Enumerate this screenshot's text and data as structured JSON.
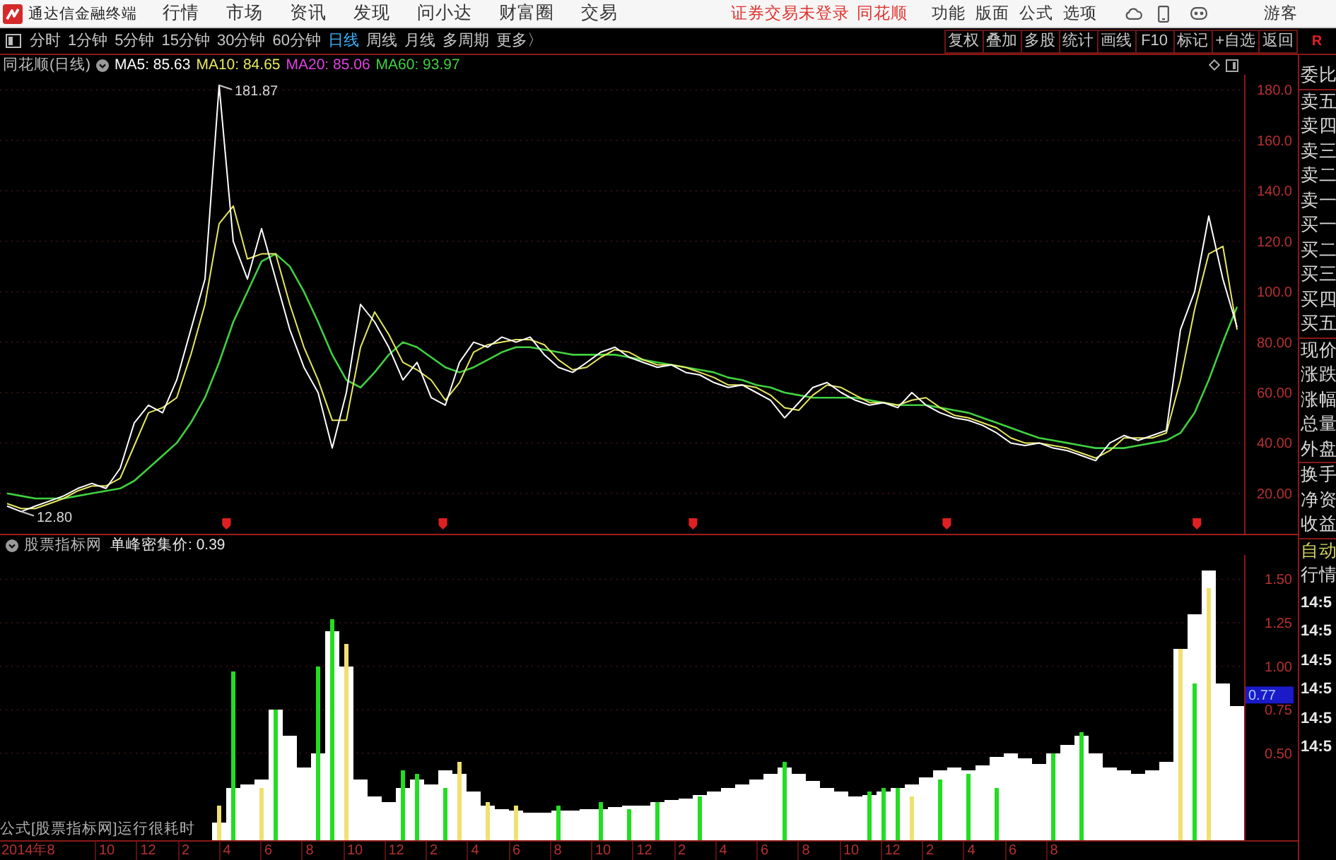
{
  "top_bar": {
    "app_title": "通达信金融终端",
    "menu": [
      "行情",
      "市场",
      "资讯",
      "发现",
      "问小达",
      "财富圈",
      "交易"
    ],
    "login_status": "证券交易未登录",
    "broker": "同花顺",
    "right_menu": [
      "功能",
      "版面",
      "公式",
      "选项"
    ],
    "user": "游客"
  },
  "toolbar": {
    "periods": [
      {
        "label": "分时",
        "selected": false
      },
      {
        "label": "1分钟",
        "selected": false
      },
      {
        "label": "5分钟",
        "selected": false
      },
      {
        "label": "15分钟",
        "selected": false
      },
      {
        "label": "30分钟",
        "selected": false
      },
      {
        "label": "60分钟",
        "selected": false
      },
      {
        "label": "日线",
        "selected": true
      },
      {
        "label": "周线",
        "selected": false
      },
      {
        "label": "月线",
        "selected": false
      },
      {
        "label": "多周期",
        "selected": false
      }
    ],
    "more_button": "更多〉",
    "buttons": [
      "复权",
      "叠加",
      "多股",
      "统计",
      "画线",
      "F10",
      "标记",
      "+自选",
      "返回"
    ],
    "corner_mark": "R"
  },
  "main_chart": {
    "title": "同花顺(日线)",
    "ma_readings": [
      {
        "text": "MA5: 85.63",
        "color": "#ffffff"
      },
      {
        "text": "MA10: 84.65",
        "color": "#e8e860"
      },
      {
        "text": "MA20: 85.06",
        "color": "#e040e0"
      },
      {
        "text": "MA60: 93.97",
        "color": "#40d040"
      }
    ],
    "chart_data": {
      "type": "line",
      "ylim": [
        4,
        186
      ],
      "grid": true,
      "yticks": [
        {
          "value": 180,
          "label": "180.0"
        },
        {
          "value": 160,
          "label": "160.0"
        },
        {
          "value": 140,
          "label": "140.0"
        },
        {
          "value": 120,
          "label": "120.0"
        },
        {
          "value": 100,
          "label": "100.0"
        },
        {
          "value": 80,
          "label": "80.00"
        },
        {
          "value": 60,
          "label": "60.00"
        },
        {
          "value": 40,
          "label": "40.00"
        },
        {
          "value": 20,
          "label": "20.00"
        }
      ],
      "series": [
        {
          "color": "#40d040",
          "values": [
            20,
            19,
            18,
            18,
            18,
            19,
            20,
            21,
            22,
            25,
            30,
            35,
            40,
            48,
            58,
            72,
            88,
            100,
            112,
            115,
            110,
            100,
            88,
            75,
            65,
            62,
            68,
            75,
            80,
            78,
            74,
            70,
            68,
            70,
            73,
            76,
            78,
            78,
            77,
            76,
            75,
            75,
            75,
            75,
            74,
            73,
            72,
            71,
            70,
            69,
            68,
            66,
            65,
            63,
            62,
            60,
            59,
            58,
            58,
            58,
            58,
            57,
            56,
            55,
            55,
            55,
            54,
            53,
            52,
            50,
            48,
            46,
            44,
            42,
            41,
            40,
            39,
            38,
            38,
            38,
            39,
            40,
            41,
            44,
            52,
            65,
            80,
            94
          ]
        },
        {
          "color": "#e8e860",
          "values": [
            16,
            14,
            14,
            16,
            18,
            21,
            23,
            23,
            26,
            39,
            52,
            54,
            58,
            75,
            95,
            127,
            134,
            113,
            115,
            115,
            95,
            78,
            65,
            49,
            49,
            78,
            92,
            83,
            72,
            69,
            65,
            57,
            64,
            76,
            79,
            80,
            81,
            81,
            79,
            73,
            69,
            70,
            74,
            77,
            76,
            73,
            71,
            71,
            70,
            68,
            66,
            63,
            63,
            62,
            59,
            54,
            53,
            59,
            63,
            62,
            59,
            56,
            56,
            55,
            57,
            58,
            54,
            51,
            50,
            48,
            46,
            42,
            40,
            40,
            39,
            38,
            36,
            34,
            37,
            42,
            42,
            42,
            44,
            65,
            93,
            115,
            118,
            85
          ]
        },
        {
          "color": "#ffffff",
          "values": [
            15,
            12.8,
            15,
            17,
            19,
            22,
            24,
            22,
            30,
            48,
            55,
            52,
            65,
            85,
            105,
            181.87,
            120,
            105,
            125,
            105,
            85,
            70,
            60,
            38,
            60,
            95,
            88,
            78,
            65,
            72,
            58,
            55,
            72,
            80,
            78,
            82,
            80,
            82,
            75,
            70,
            68,
            72,
            76,
            78,
            74,
            72,
            70,
            71,
            68,
            67,
            64,
            62,
            63,
            60,
            57,
            50,
            56,
            62,
            64,
            60,
            57,
            55,
            56,
            54,
            60,
            55,
            52,
            50,
            49,
            47,
            44,
            40,
            39,
            40,
            38,
            37,
            35,
            33,
            40,
            43,
            41,
            43,
            45,
            85,
            100,
            130,
            105,
            86
          ]
        }
      ],
      "annotations": [
        "181.87",
        "12.80"
      ]
    }
  },
  "indicator_chart": {
    "name": "股票指标网",
    "reading": "单峰密集价: 0.39",
    "note": "公式[股票指标网]运行很耗时",
    "chart_data": {
      "type": "bar",
      "ylim": [
        0,
        1.64
      ],
      "grid": true,
      "yticks": [
        {
          "value": 1.5,
          "label": "1.50"
        },
        {
          "value": 1.25,
          "label": "1.25"
        },
        {
          "value": 1.0,
          "label": "1.00"
        },
        {
          "value": 0.75,
          "label": "0.75"
        },
        {
          "value": 0.5,
          "label": "0.50"
        }
      ],
      "series": [
        {
          "color": "#ffffff",
          "values": [
            0,
            0,
            0,
            0,
            0,
            0,
            0,
            0,
            0,
            0,
            0,
            0,
            0,
            0,
            0,
            0.1,
            0.3,
            0.32,
            0.35,
            0.75,
            0.6,
            0.42,
            0.5,
            1.2,
            1.0,
            0.35,
            0.25,
            0.22,
            0.3,
            0.35,
            0.32,
            0.4,
            0.38,
            0.28,
            0.2,
            0.18,
            0.17,
            0.16,
            0.16,
            0.17,
            0.17,
            0.18,
            0.18,
            0.19,
            0.2,
            0.2,
            0.22,
            0.23,
            0.24,
            0.26,
            0.28,
            0.3,
            0.32,
            0.35,
            0.38,
            0.42,
            0.38,
            0.34,
            0.3,
            0.28,
            0.25,
            0.26,
            0.28,
            0.3,
            0.32,
            0.36,
            0.4,
            0.42,
            0.4,
            0.43,
            0.48,
            0.5,
            0.47,
            0.44,
            0.5,
            0.55,
            0.6,
            0.5,
            0.42,
            0.4,
            0.38,
            0.4,
            0.45,
            1.1,
            1.3,
            1.55,
            0.9,
            0.77
          ]
        },
        {
          "color": "#22dd22",
          "values": [
            null,
            null,
            null,
            null,
            null,
            null,
            null,
            null,
            null,
            null,
            null,
            null,
            null,
            null,
            null,
            null,
            0.97,
            null,
            null,
            0.75,
            null,
            null,
            1.0,
            1.27,
            null,
            null,
            null,
            null,
            0.4,
            0.38,
            null,
            0.3,
            null,
            null,
            null,
            null,
            null,
            null,
            null,
            0.2,
            null,
            null,
            0.22,
            null,
            0.18,
            null,
            0.22,
            null,
            null,
            0.25,
            null,
            null,
            null,
            null,
            null,
            0.45,
            null,
            null,
            null,
            null,
            null,
            0.28,
            0.3,
            0.3,
            null,
            null,
            0.35,
            null,
            0.38,
            null,
            0.3,
            null,
            null,
            null,
            0.5,
            null,
            0.62,
            null,
            null,
            null,
            null,
            null,
            null,
            null,
            0.9,
            null,
            null,
            null
          ]
        },
        {
          "color": "#f0e070",
          "values": [
            null,
            null,
            null,
            null,
            null,
            null,
            null,
            null,
            null,
            null,
            null,
            null,
            null,
            null,
            null,
            0.2,
            null,
            null,
            0.3,
            null,
            null,
            null,
            null,
            null,
            1.13,
            null,
            null,
            null,
            null,
            null,
            null,
            null,
            0.45,
            null,
            0.22,
            null,
            0.2,
            null,
            null,
            null,
            null,
            null,
            null,
            null,
            null,
            null,
            null,
            null,
            null,
            null,
            null,
            null,
            null,
            null,
            null,
            null,
            null,
            null,
            null,
            null,
            null,
            null,
            null,
            null,
            0.25,
            null,
            null,
            null,
            null,
            null,
            null,
            null,
            null,
            null,
            null,
            null,
            null,
            null,
            null,
            null,
            null,
            null,
            null,
            1.1,
            null,
            1.45,
            null,
            null
          ]
        }
      ],
      "annotations": [
        "0.77"
      ]
    }
  },
  "time_axis": [
    "2014年8",
    "10",
    "12",
    "2",
    "4",
    "6",
    "8",
    "10",
    "12",
    "2",
    "4",
    "6",
    "8",
    "10",
    "12",
    "2",
    "4",
    "6",
    "8",
    "10",
    "12",
    "2",
    "4",
    "6",
    "8"
  ],
  "quote_panel": {
    "groups": [
      [
        "委比"
      ],
      [
        "卖五",
        "卖四",
        "卖三",
        "卖二",
        "卖一",
        "买一",
        "买二",
        "买三",
        "买四",
        "买五"
      ],
      [
        "现价",
        "涨跌",
        "涨幅",
        "总量",
        "外盘"
      ],
      [
        "换手",
        "净资",
        "收益"
      ]
    ],
    "mode": "自动",
    "heading": "行情",
    "times": [
      "14:5",
      "14:5",
      "14:5",
      "14:5",
      "14:5",
      "14:5"
    ]
  }
}
